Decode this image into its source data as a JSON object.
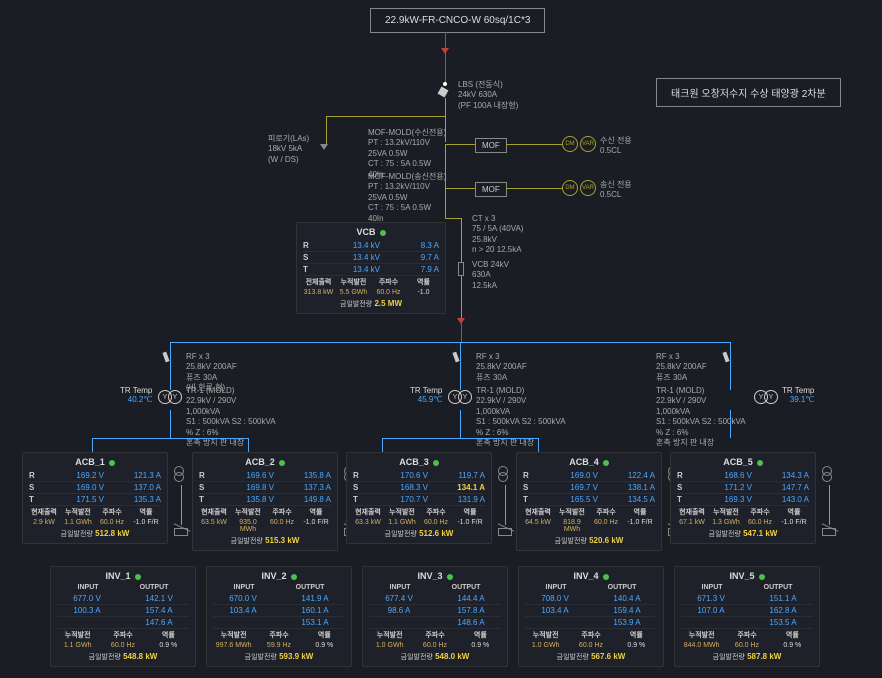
{
  "header": {
    "title": "22.9kW-FR-CNCO-W 60sq/1C*3",
    "site": "태크원 오창저수지 수상 태양광 2차분"
  },
  "lbs": {
    "l1": "LBS (전동식)",
    "l2": "24kV 630A",
    "l3": "(PF 100A 내장형)"
  },
  "la": {
    "l1": "피로기(LAs)",
    "l2": "18kV 5kA",
    "l3": "(W / DS)"
  },
  "mof1": {
    "title": "MOF-MOLD(수신전용)",
    "l1": "PT : 13.2kV/110V",
    "l2": "25VA 0.5W",
    "l3": "CT : 75 : 5A 0.5W",
    "l4": "40In",
    "side": "수신 전용",
    "scl": "0.5CL"
  },
  "mof2": {
    "title": "MOF-MOLD(송신전용)",
    "l1": "PT : 13.2kV/110V",
    "l2": "25VA 0.5W",
    "l3": "CT : 75 : 5A 0.5W",
    "l4": "40In",
    "side": "송신 전용",
    "scl": "0.5CL"
  },
  "ct": {
    "l1": "CT x 3",
    "l2": "75 / 5A (40VA)",
    "l3": "25.8kV",
    "l4": "n > 20 12.5kA"
  },
  "vcb_side": {
    "l1": "VCB 24kV",
    "l2": "630A",
    "l3": "12.5kA"
  },
  "vcb": {
    "title": "VCB",
    "r": {
      "v": "13.4 kV",
      "a": "8.3 A"
    },
    "s": {
      "v": "13.4 kV",
      "a": "9.7 A"
    },
    "t": {
      "v": "13.4 kV",
      "a": "7.9 A"
    },
    "hdr": [
      "전체출력",
      "누적발전",
      "주파수",
      "역률"
    ],
    "vals": [
      "313.8 kW",
      "5.5 GWh",
      "60.0 Hz",
      "-1.0"
    ],
    "gen_label": "금일발전량",
    "gen_val": "2.5 MW"
  },
  "rf": {
    "l1": "RF x 3",
    "l2": "25.8kV 200AF",
    "l3": "퓨즈 30A",
    "l4": "(비 한류 형)"
  },
  "tr": {
    "l1": "TR-1 (MOLD)",
    "l2": "22.9kV / 290V",
    "l3": "1,000kVA",
    "l4": "S1 : 500kVA S2 : 500kVA",
    "l5": "% Z : 6%",
    "l6": "혼촉 방지 판 내장"
  },
  "tr_temp": [
    {
      "label": "TR Temp",
      "v": "40.2℃"
    },
    {
      "label": "TR Temp",
      "v": "45.9℃"
    },
    {
      "label": "TR Temp",
      "v": "39.1℃"
    }
  ],
  "acb": [
    {
      "title": "ACB_1",
      "r": [
        "169.2 V",
        "121.3 A"
      ],
      "s": [
        "169.0 V",
        "137.0 A"
      ],
      "t": [
        "171.5 V",
        "135.3 A"
      ],
      "vals": [
        "2.9 kW",
        "1.1 GWh",
        "60.0 Hz",
        "-1.0 F/R"
      ],
      "gen": "512.8 kW"
    },
    {
      "title": "ACB_2",
      "r": [
        "169.6 V",
        "135.8 A"
      ],
      "s": [
        "169.8 V",
        "137.3 A"
      ],
      "t": [
        "135.8 V",
        "149.8 A"
      ],
      "vals": [
        "63.5 kW",
        "935.0 MWh",
        "60.0 Hz",
        "-1.0 F/R"
      ],
      "gen": "515.3 kW"
    },
    {
      "title": "ACB_3",
      "r": [
        "170.6 V",
        "119.7 A"
      ],
      "s": [
        "168.3 V",
        "134.1 A"
      ],
      "t": [
        "170.7 V",
        "131.9 A"
      ],
      "vals": [
        "63.3 kW",
        "1.1 GWh",
        "60.0 Hz",
        "-1.0 F/R"
      ],
      "gen": "512.6 kW",
      "highlight_s": true
    },
    {
      "title": "ACB_4",
      "r": [
        "169.0 V",
        "122.4 A"
      ],
      "s": [
        "169.7 V",
        "138.1 A"
      ],
      "t": [
        "165.5 V",
        "134.5 A"
      ],
      "vals": [
        "64.5 kW",
        "818.9 MWh",
        "60.0 Hz",
        "-1.0 F/R"
      ],
      "gen": "520.6 kW"
    },
    {
      "title": "ACB_5",
      "r": [
        "168.6 V",
        "134.3 A"
      ],
      "s": [
        "171.2 V",
        "147.7 A"
      ],
      "t": [
        "169.3 V",
        "143.0 A"
      ],
      "vals": [
        "67.1 kW",
        "1.3 GWh",
        "60.0 Hz",
        "-1.0 F/R"
      ],
      "gen": "547.1 kW"
    }
  ],
  "acb_hdr": [
    "현재출력",
    "누적발전",
    "주파수",
    "역률"
  ],
  "acb_gen_label": "금일발전량",
  "inv": [
    {
      "title": "INV_1",
      "in": [
        "677.0 V",
        "100.3 A",
        ""
      ],
      "out": [
        "142.1 V",
        "157.4 A",
        "147.6 A"
      ],
      "hdr": [
        "누적발전",
        "주파수",
        "역률"
      ],
      "vals": [
        "1.1 GWh",
        "60.0 Hz",
        "0.9 %"
      ],
      "gen": "548.8 kW"
    },
    {
      "title": "INV_2",
      "in": [
        "670.0 V",
        "103.4 A",
        ""
      ],
      "out": [
        "141.9 A",
        "160.1 A",
        "153.1 A"
      ],
      "hdr": [
        "누적발전",
        "주파수",
        "역률"
      ],
      "vals": [
        "997.6 MWh",
        "59.9 Hz",
        "0.9 %"
      ],
      "gen": "593.9 kW"
    },
    {
      "title": "INV_3",
      "in": [
        "677.4 V",
        "98.6 A",
        ""
      ],
      "out": [
        "144.4 A",
        "157.8 A",
        "148.6 A"
      ],
      "hdr": [
        "누적발전",
        "주파수",
        "역률"
      ],
      "vals": [
        "1.0 GWh",
        "60.0 Hz",
        "0.9 %"
      ],
      "gen": "548.0 kW"
    },
    {
      "title": "INV_4",
      "in": [
        "708.0 V",
        "103.4 A",
        ""
      ],
      "out": [
        "140.4 A",
        "159.4 A",
        "153.9 A"
      ],
      "hdr": [
        "누적발전",
        "주파수",
        "역률"
      ],
      "vals": [
        "1.0 GWh",
        "60.0 Hz",
        "0.9 %"
      ],
      "gen": "567.6 kW"
    },
    {
      "title": "INV_5",
      "in": [
        "671.3 V",
        "107.0 A",
        ""
      ],
      "out": [
        "151.1 A",
        "162.8 A",
        "153.5 A"
      ],
      "hdr": [
        "누적발전",
        "주파수",
        "역률"
      ],
      "vals": [
        "844.0 MWh",
        "60.0 Hz",
        "0.9 %"
      ],
      "gen": "587.8 kW"
    }
  ]
}
